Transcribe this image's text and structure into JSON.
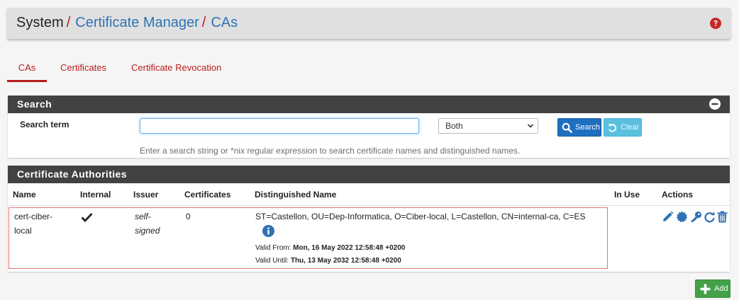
{
  "breadcrumb": {
    "root": "System",
    "section": "Certificate Manager",
    "page": "CAs",
    "separator": "/"
  },
  "tabs": [
    {
      "label": "CAs",
      "active": true
    },
    {
      "label": "Certificates",
      "active": false
    },
    {
      "label": "Certificate Revocation",
      "active": false
    }
  ],
  "search_panel": {
    "title": "Search",
    "term_label": "Search term",
    "term_value": "",
    "scope_selected": "Both",
    "search_button": "Search",
    "clear_button": "Clear",
    "help_text": "Enter a search string or *nix regular expression to search certificate names and distinguished names."
  },
  "ca_panel": {
    "title": "Certificate Authorities",
    "columns": [
      "Name",
      "Internal",
      "Issuer",
      "Certificates",
      "Distinguished Name",
      "In Use",
      "Actions"
    ],
    "rows": [
      {
        "name_line1": "cert-ciber-",
        "name_line2": "local",
        "internal": true,
        "issuer_line1": "self-",
        "issuer_line2": "signed",
        "certificates": "0",
        "distinguished_name": "ST=Castellon, OU=Dep-Informatica, O=Ciber-local, L=Castellon, CN=internal-ca, C=ES",
        "valid_from_label": "Valid From:",
        "valid_from": "Mon, 16 May 2022 12:58:48 +0200",
        "valid_until_label": "Valid Until:",
        "valid_until": "Thu, 13 May 2032 12:58:48 +0200",
        "in_use": ""
      }
    ]
  },
  "add_button": "Add",
  "colors": {
    "accent_red": "#b71c1c",
    "link_blue": "#2f72b4",
    "panel_dark": "#424242",
    "action_blue": "#1e6fbf",
    "add_green": "#43a047"
  },
  "icons": [
    "help-icon",
    "collapse-icon",
    "search-icon",
    "undo-icon",
    "check-icon",
    "info-icon",
    "pencil-icon",
    "certificate-icon",
    "key-icon",
    "refresh-icon",
    "trash-icon",
    "plus-icon"
  ]
}
